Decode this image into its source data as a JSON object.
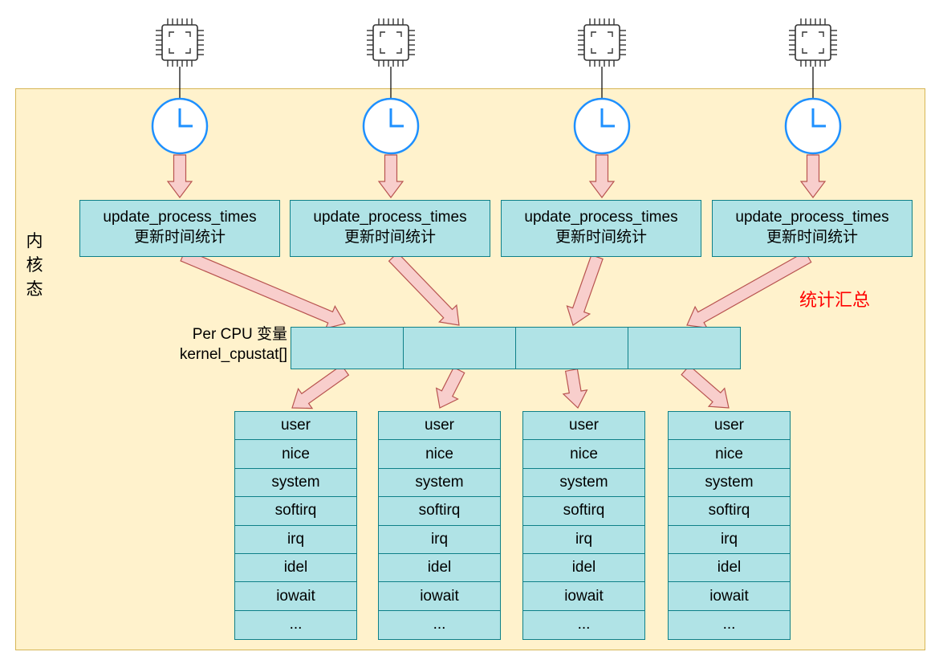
{
  "kernel_space_label": [
    "内",
    "核",
    "态"
  ],
  "summary_label": "统计汇总",
  "per_cpu_label": [
    "Per CPU 变量",
    "kernel_cpustat[]"
  ],
  "colors": {
    "kernel_fill": "#fff2cc",
    "kernel_border": "#d6b656",
    "box_fill": "#b0e3e6",
    "box_border": "#0e8088",
    "arrow_fill": "#f8cecc",
    "arrow_border": "#b85450",
    "clock_fill": "#ffffff",
    "clock_border": "#1e90ff",
    "summary_text": "#ff0000"
  },
  "icons": [
    "cpu-chip-icon",
    "clock-icon"
  ],
  "update_boxes": [
    {
      "function": "update_process_times",
      "caption": "更新时间统计"
    },
    {
      "function": "update_process_times",
      "caption": "更新时间统计"
    },
    {
      "function": "update_process_times",
      "caption": "更新时间统计"
    },
    {
      "function": "update_process_times",
      "caption": "更新时间统计"
    }
  ],
  "cpustat_fields": [
    "user",
    "nice",
    "system",
    "softirq",
    "irq",
    "idel",
    "iowait",
    "..."
  ],
  "cpustat_columns": 4
}
